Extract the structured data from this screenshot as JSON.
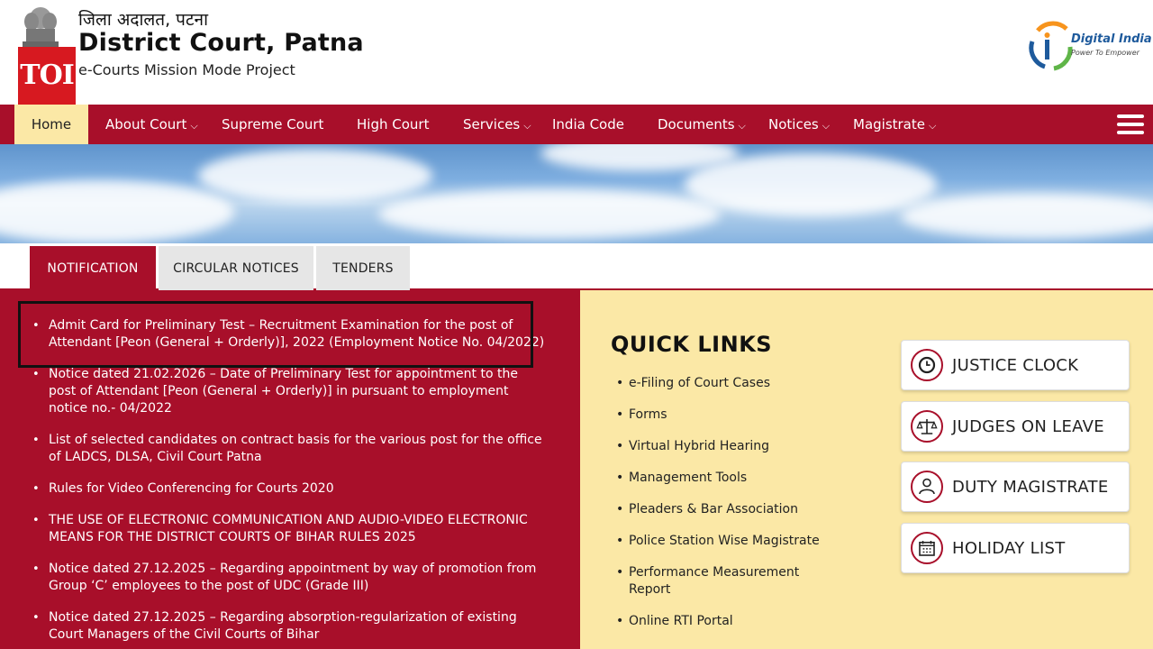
{
  "header": {
    "hindi_title": "जिला अदालत, पटना",
    "court_name": "District Court, Patna",
    "subtitle": "e-Courts Mission Mode Project",
    "toi_badge": "TOI",
    "digital_india_title": "Digital India",
    "digital_india_tagline": "Power To Empower",
    "emblem_icon": "state-emblem-icon"
  },
  "nav": {
    "items": [
      {
        "label": "Home",
        "active": true
      },
      {
        "label": "About Court",
        "dropdown": true
      },
      {
        "label": "Supreme Court"
      },
      {
        "label": "High Court"
      },
      {
        "label": "Services",
        "dropdown": true
      },
      {
        "label": "India Code"
      },
      {
        "label": "Documents",
        "dropdown": true
      },
      {
        "label": "Notices",
        "dropdown": true
      },
      {
        "label": "Magistrate",
        "dropdown": true
      }
    ],
    "menu_icon": "hamburger-menu-icon"
  },
  "tabs": [
    {
      "label": "NOTIFICATION",
      "active": true
    },
    {
      "label": "CIRCULAR NOTICES",
      "active": false
    },
    {
      "label": "TENDERS",
      "active": false
    }
  ],
  "notices": [
    "Admit Card for Preliminary Test – Recruitment Examination for the post of Attendant [Peon (General + Orderly)], 2022 (Employment Notice No. 04/2022)",
    "Notice dated 21.02.2026 – Date of Preliminary Test for appointment to the post of Attendant [Peon (General + Orderly)] in pursuant to employment notice no.- 04/2022",
    "List of selected candidates on contract basis for the various post for the office of LADCS, DLSA, Civil Court Patna",
    "Rules for Video Conferencing for Courts 2020",
    "THE USE OF ELECTRONIC COMMUNICATION AND AUDIO-VIDEO ELECTRONIC MEANS FOR THE DISTRICT COURTS OF BIHAR RULES 2025",
    "Notice dated 27.12.2025 – Regarding appointment by way of promotion from Group ‘C’ employees to the post of UDC (Grade III)",
    "Notice dated 27.12.2025 – Regarding absorption-regularization of existing Court Managers of the Civil Courts of Bihar"
  ],
  "quick_links": {
    "title": "QUICK LINKS",
    "items": [
      "e-Filing of Court Cases",
      "Forms",
      "Virtual Hybrid Hearing",
      "Management Tools",
      "Pleaders & Bar Association",
      "Police Station Wise Magistrate",
      "Performance Measurement Report",
      "Online RTI Portal"
    ],
    "buttons": [
      {
        "label": "JUSTICE CLOCK",
        "icon": "clock-icon"
      },
      {
        "label": "JUDGES ON LEAVE",
        "icon": "scales-icon"
      },
      {
        "label": "DUTY MAGISTRATE",
        "icon": "person-icon"
      },
      {
        "label": "HOLIDAY LIST",
        "icon": "calendar-icon"
      }
    ]
  },
  "colors": {
    "primary": "#a80f2a",
    "active_nav": "#fbe8a6",
    "quick_bg": "#fbe8a6",
    "toi_red": "#d71920"
  }
}
